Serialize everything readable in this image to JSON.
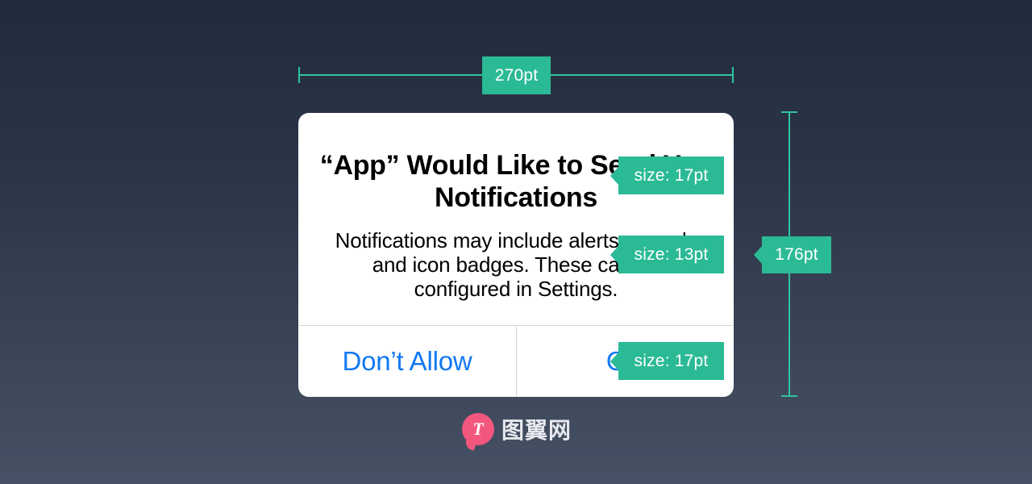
{
  "background": {
    "gradient_top": "#222b3c",
    "gradient_bottom": "#475165"
  },
  "accent": {
    "teal": "#2bba96",
    "ruler": "#2fc49d",
    "ios_blue": "#1279f2",
    "watermark_pink": "#f4577e"
  },
  "dialog": {
    "title": "“App” Would Like to Send You Notifications",
    "message": "Notifications may include alerts, sounds and icon badges. These can be configured in Settings.",
    "buttons": [
      {
        "label": "Don’t Allow"
      },
      {
        "label": "OK"
      }
    ]
  },
  "measurements": {
    "width_label": "270pt",
    "height_label": "176pt"
  },
  "annotations": [
    {
      "label": "size: 17pt",
      "target": "dialog-title"
    },
    {
      "label": "size: 13pt",
      "target": "dialog-message"
    },
    {
      "label": "size: 17pt",
      "target": "dialog-button"
    }
  ],
  "watermark": {
    "logo_letter": "T",
    "text": "图翼网"
  }
}
